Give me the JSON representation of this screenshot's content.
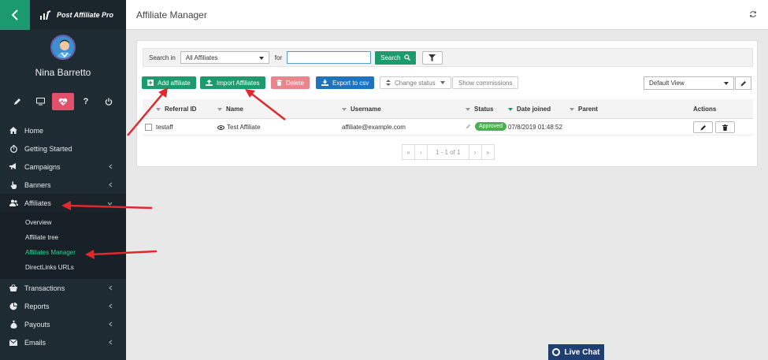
{
  "brand": {
    "name": "Post Affiliate Pro"
  },
  "user": {
    "name": "Nina Barretto"
  },
  "sidebar": {
    "items": [
      {
        "label": "Home",
        "icon": "home-icon"
      },
      {
        "label": "Getting Started",
        "icon": "stopwatch-icon"
      },
      {
        "label": "Campaigns",
        "icon": "megaphone-icon"
      },
      {
        "label": "Banners",
        "icon": "hand-pointer-icon"
      },
      {
        "label": "Affiliates",
        "icon": "users-icon"
      },
      {
        "label": "Transactions",
        "icon": "basket-icon"
      },
      {
        "label": "Reports",
        "icon": "pie-chart-icon"
      },
      {
        "label": "Payouts",
        "icon": "money-bag-icon"
      },
      {
        "label": "Emails",
        "icon": "envelope-icon"
      }
    ],
    "affiliates_sub": [
      "Overview",
      "Affiliate tree",
      "Affiliates Manager",
      "DirectLinks URLs"
    ]
  },
  "header": {
    "title": "Affiliate Manager"
  },
  "search": {
    "search_in_label": "Search in",
    "search_in_value": "All Affiliates",
    "for_label": "for",
    "query": "",
    "search_button": "Search"
  },
  "toolbar": {
    "add": "Add affiliate",
    "import": "Import Affiliates",
    "delete": "Delete",
    "export": "Export to csv",
    "change_status": "Change status",
    "show_commissions": "Show commissions",
    "view": "Default View"
  },
  "table": {
    "columns": [
      "Referral ID",
      "Name",
      "Username",
      "Status",
      "Date joined",
      "Parent",
      "Actions"
    ],
    "rows": [
      {
        "referral_id": "testaff",
        "name": "Test Affiliate",
        "username": "affiliate@example.com",
        "status": "Approved",
        "date_joined": "07/8/2019 01:48:52",
        "parent": ""
      }
    ]
  },
  "pager": {
    "first": "«",
    "prev": "‹",
    "info": "1 - 1 of 1",
    "next": "›",
    "last": "»"
  },
  "livechat": {
    "label": "Live Chat"
  },
  "colors": {
    "accent": "#1f9a6f",
    "sidebar": "#1f2b33",
    "active_sub": "#2fd19a",
    "danger": "#e8868c",
    "primary": "#1e73be",
    "arrow": "#e0282e"
  }
}
